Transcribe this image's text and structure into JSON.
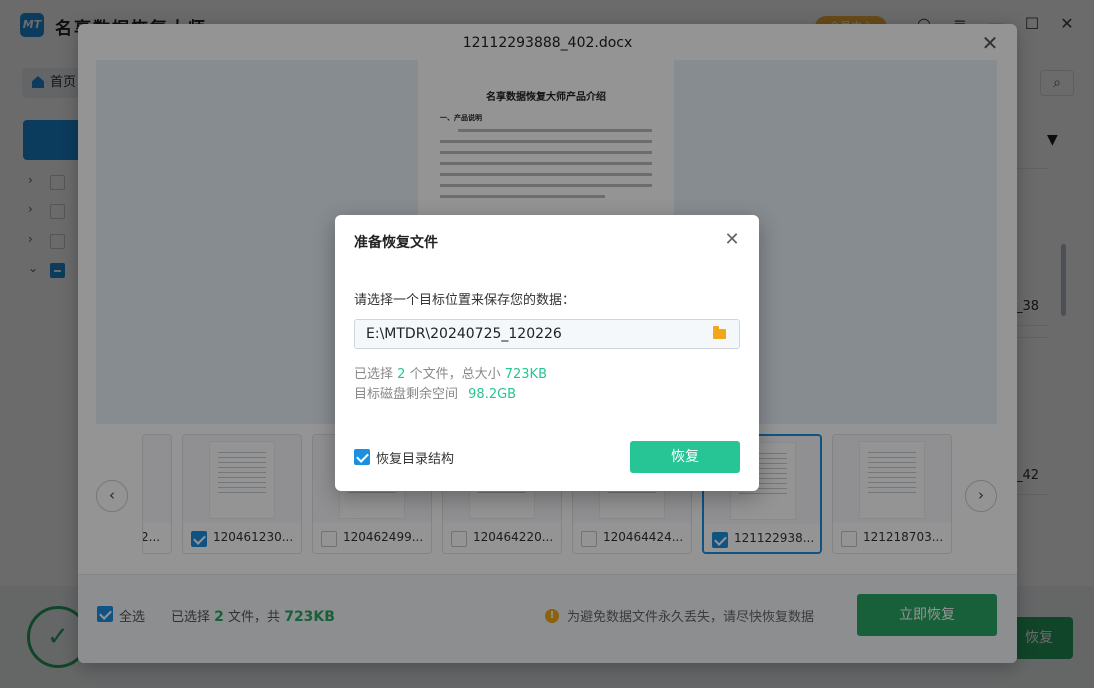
{
  "app": {
    "name": "名享数据恢复大师",
    "logo_text": "MT",
    "member_badge": "会员中心",
    "home_label": "首页",
    "tree_rows": 4,
    "right_cards": [
      "_38",
      "_42"
    ],
    "bg_recover_label": "恢复"
  },
  "preview": {
    "title": "12112293888_402.docx",
    "doc": {
      "heading": "名享数据恢复大师产品介绍",
      "section": "一、产品说明"
    },
    "thumbnails": [
      {
        "name": "2...",
        "checked": false,
        "active": false
      },
      {
        "name": "120461230...",
        "checked": true,
        "active": false
      },
      {
        "name": "120462499...",
        "checked": false,
        "active": false
      },
      {
        "name": "120464220...",
        "checked": false,
        "active": false
      },
      {
        "name": "120464424...",
        "checked": false,
        "active": false
      },
      {
        "name": "121122938...",
        "checked": true,
        "active": true
      },
      {
        "name": "121218703...",
        "checked": false,
        "active": false
      }
    ],
    "footer": {
      "select_all": "全选",
      "summary_prefix": "已选择",
      "count": "2",
      "summary_mid": "文件，共",
      "size": "723KB",
      "warning": "为避免数据文件永久丢失，请尽快恢复数据",
      "recover_button": "立即恢复"
    }
  },
  "dialog": {
    "title": "准备恢复文件",
    "prompt": "请选择一个目标位置来保存您的数据：",
    "path": "E:\\MTDR\\20240725_120226",
    "selected_prefix": "已选择",
    "selected_count": "2",
    "selected_mid": "个文件，总大小",
    "selected_size": "723KB",
    "free_label": "目标磁盘剩余空间",
    "free_value": "98.2GB",
    "keep_structure_label": "恢复目录结构",
    "keep_structure_checked": true,
    "recover_button": "恢复"
  }
}
